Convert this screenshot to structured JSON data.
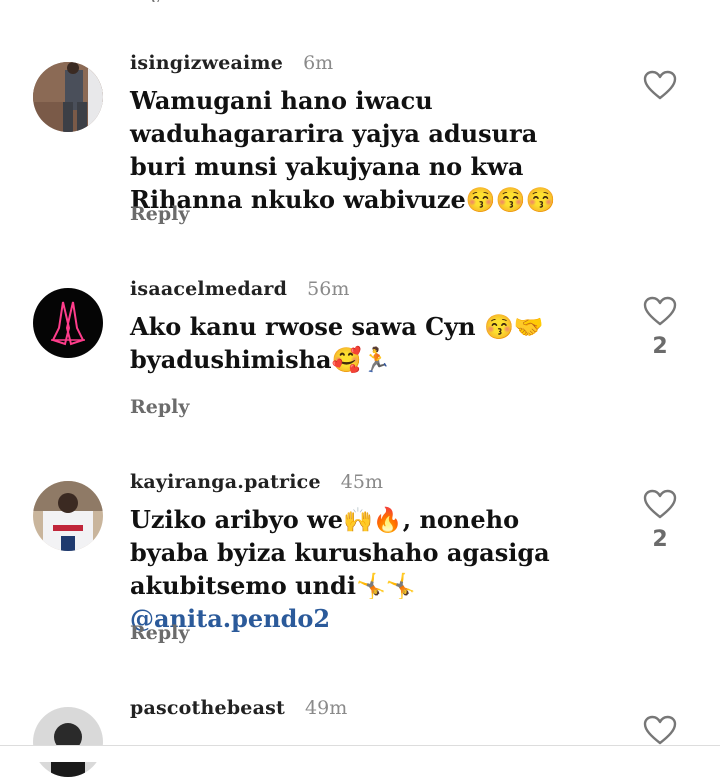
{
  "comments": [
    {
      "username": "isingizweaime",
      "time": "6m",
      "text": "Wamugani hano iwacu waduhagararira yajya adusura buri munsi yakujyana no kwa Rihanna nkuko wabivuze😚😚😚",
      "reply_label": "Reply",
      "like_count": ""
    },
    {
      "username": "isaacelmedard",
      "time": "56m",
      "text": "Ako kanu rwose sawa Cyn 😚🤝 byadushimisha🥰🏃",
      "reply_label": "Reply",
      "like_count": "2"
    },
    {
      "username": "kayiranga.patrice",
      "time": "45m",
      "text": "Uziko aribyo we🙌🔥, noneho byaba byiza kurushaho agasiga akubitsemo undi🤸🤸 ",
      "mention": "@anita.pendo2",
      "reply_label": "Reply",
      "like_count": "2"
    },
    {
      "username": "pascothebeast",
      "time": "49m",
      "reply_label": "",
      "like_count": ""
    }
  ],
  "colors": {
    "accent_mention": "#2b5a9a",
    "muted": "#6b6b6b"
  }
}
